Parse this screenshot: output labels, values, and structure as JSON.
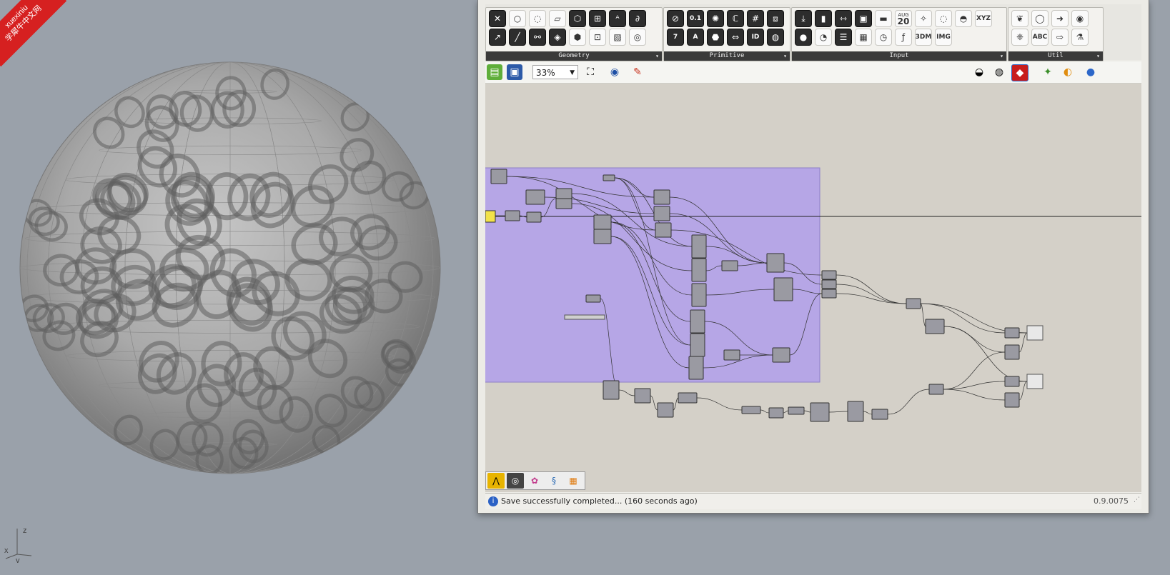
{
  "viewport": {
    "watermark": {
      "line1": "xuexiniu",
      "line2": "学犀牛中文网"
    },
    "axis": {
      "z": "z",
      "x": "x",
      "y": "y"
    }
  },
  "grasshopper": {
    "ribbon": {
      "panels": [
        {
          "name": "Geometry",
          "icons": [
            "hexagon-x-icon",
            "circle-icon",
            "scatter-icon",
            "surface-icon",
            "box-icon",
            "mesh-icon",
            "text-icon",
            "curve-icon",
            "vector-icon",
            "line-icon",
            "link-icon",
            "transform-icon",
            "brep-icon",
            "field-icon",
            "plane-icon",
            "spiral-icon"
          ]
        },
        {
          "name": "Primitive",
          "icons": [
            "boolean-icon",
            "number-icon",
            "gear-icon",
            "complex-icon",
            "grid-icon",
            "data-icon",
            "integer-icon",
            "string-icon",
            "shape-icon",
            "domain-icon",
            "id-icon",
            "color-icon"
          ]
        },
        {
          "name": "Input",
          "icons": [
            "download-icon",
            "toggle-icon",
            "slider-icon",
            "panel-icon",
            "gradient-icon",
            "calendar-icon",
            "palette-icon",
            "color-wheel-icon",
            "graph-icon",
            "xyz-icon",
            "param-icon",
            "dial-icon",
            "list-icon",
            "matrix-icon",
            "clock-icon",
            "function-icon",
            "3dm-icon",
            "img-icon"
          ]
        },
        {
          "name": "Util",
          "icons": [
            "cherry-icon",
            "ring-icon",
            "arrow-icon",
            "disc-icon",
            "tree-icon",
            "abc-icon",
            "outline-arrow-icon",
            "flask-icon"
          ]
        }
      ],
      "calendar_text": {
        "month": "AUG",
        "day": "20"
      },
      "xyz_label": "XYZ",
      "d3_label": "3DM",
      "img_label": "IMG",
      "abc_label": "ABC",
      "number_label": "0.1",
      "seven_label": "7",
      "a_label": "A",
      "id_label": "ID"
    },
    "toolbar": {
      "zoom": "33%"
    },
    "status": {
      "message": "Save successfully completed... (160 seconds ago)",
      "version": "0.9.0075"
    },
    "colors": {
      "group": "#b6a6e6",
      "component": "#9a9aa2",
      "canvas": "#d4d0c8"
    }
  }
}
